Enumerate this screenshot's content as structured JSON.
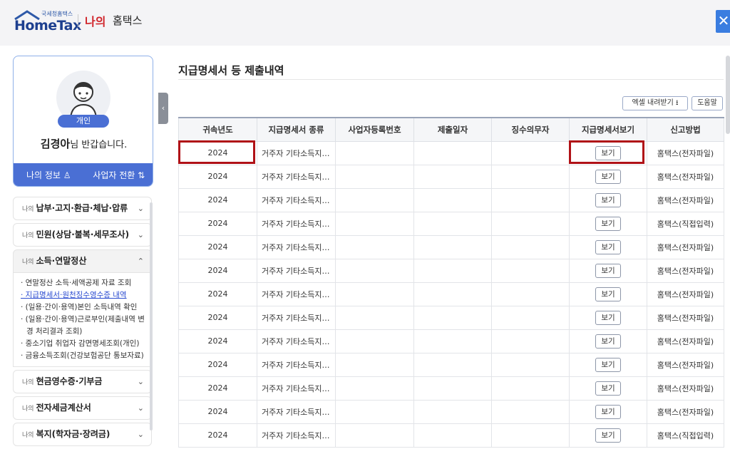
{
  "header": {
    "logo_small": "국세청홈택스",
    "logo_main": "HomeTax",
    "brand_my": "나의",
    "brand_name": "홈택스",
    "close_label": "✕"
  },
  "profile": {
    "badge": "개인",
    "user_name": "김경아",
    "greeting_suffix": "님 반갑습니다.",
    "my_info_label": "나의 정보",
    "switch_label": "사업자 전환"
  },
  "sidebar": {
    "collapse_label": "‹",
    "menu": [
      {
        "prefix": "나의",
        "label": "납부·고지·환급·체납·압류",
        "chevron": "⌄"
      },
      {
        "prefix": "나의",
        "label": "민원(상담·불복·세무조사)",
        "chevron": "⌄"
      },
      {
        "prefix": "나의",
        "label": "소득·연말정산",
        "chevron": "⌃"
      },
      {
        "prefix": "나의",
        "label": "현금영수증·기부금",
        "chevron": "⌄"
      },
      {
        "prefix": "나의",
        "label": "전자세금계산서",
        "chevron": "⌄"
      },
      {
        "prefix": "나의",
        "label": "복지(학자금·장려금)",
        "chevron": "⌄"
      }
    ],
    "submenu": [
      "· 연말정산 소득·세액공제 자료 조회",
      "· 지급명세서·원천징수영수증 내역",
      "· (일용·간이·용역)본인 소득내역 확인",
      "· (일용·간이·용역)근로부인(제출내역 변경 처리결과 조회)",
      "· 중소기업 취업자 감면명세조회(개인)",
      "· 금융소득조회(건강보험공단 통보자료)"
    ]
  },
  "main": {
    "title": "지급명세서 등 제출내역",
    "excel_label": "엑셀 내려받기",
    "help_label": "도움말",
    "columns": [
      "귀속년도",
      "지급명세서 종류",
      "사업자등록번호",
      "제출일자",
      "징수의무자",
      "지급명세서보기",
      "신고방법"
    ],
    "view_label": "보기",
    "rows": [
      {
        "year": "2024",
        "type": "거주자 기타소득지…",
        "method": "홈택스(전자파일)"
      },
      {
        "year": "2024",
        "type": "거주자 기타소득지…",
        "method": "홈택스(전자파일)"
      },
      {
        "year": "2024",
        "type": "거주자 기타소득지…",
        "method": "홈택스(전자파일)"
      },
      {
        "year": "2024",
        "type": "거주자 기타소득지…",
        "method": "홈택스(직접입력)"
      },
      {
        "year": "2024",
        "type": "거주자 기타소득지…",
        "method": "홈택스(전자파일)"
      },
      {
        "year": "2024",
        "type": "거주자 기타소득지…",
        "method": "홈택스(전자파일)"
      },
      {
        "year": "2024",
        "type": "거주자 기타소득지…",
        "method": "홈택스(전자파일)"
      },
      {
        "year": "2024",
        "type": "거주자 기타소득지…",
        "method": "홈택스(전자파일)"
      },
      {
        "year": "2024",
        "type": "거주자 기타소득지…",
        "method": "홈택스(전자파일)"
      },
      {
        "year": "2024",
        "type": "거주자 기타소득지…",
        "method": "홈택스(전자파일)"
      },
      {
        "year": "2024",
        "type": "거주자 기타소득지…",
        "method": "홈택스(전자파일)"
      },
      {
        "year": "2024",
        "type": "거주자 기타소득지…",
        "method": "홈택스(전자파일)"
      },
      {
        "year": "2024",
        "type": "거주자 기타소득지…",
        "method": "홈택스(직접입력)"
      }
    ]
  },
  "colors": {
    "accent": "#4a6fd4",
    "brand_red": "#d0262c",
    "highlight": "#b01217"
  }
}
